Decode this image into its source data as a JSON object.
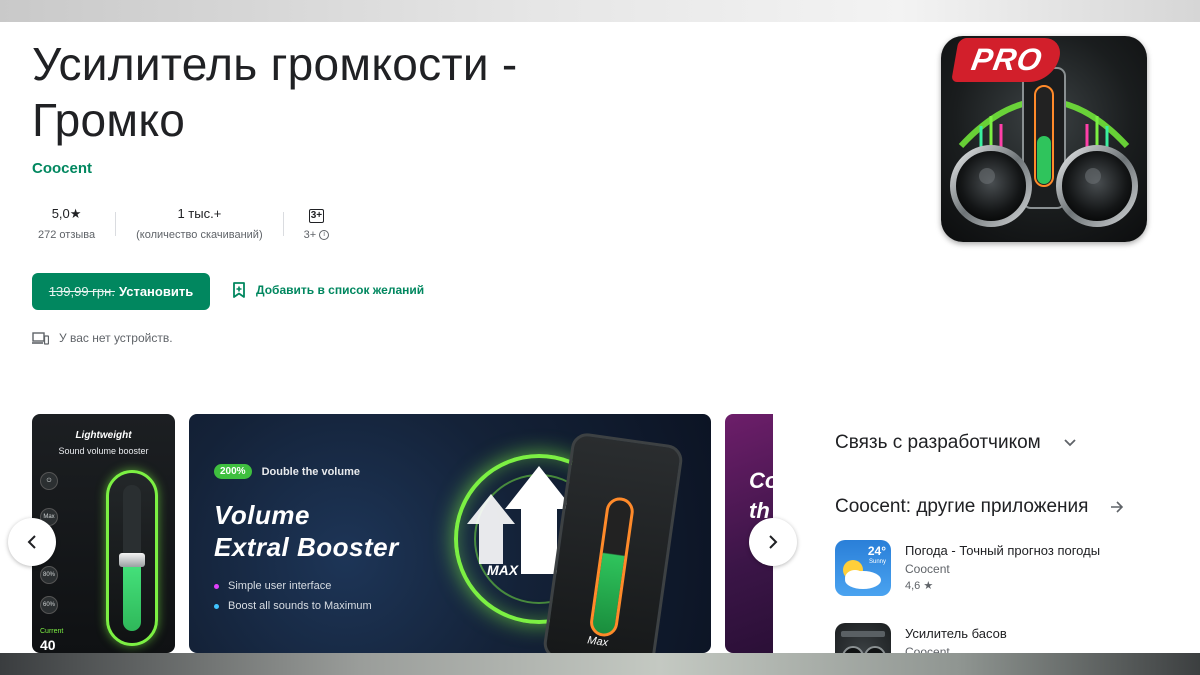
{
  "app": {
    "title_line1": "Усилитель громкости -",
    "title_line2": "Громко",
    "developer": "Coocent",
    "icon_badge": "PRO"
  },
  "stats": {
    "rating": "5,0",
    "rating_star": "★",
    "reviews": "272 отзыва",
    "downloads": "1 тыс.+",
    "downloads_label": "(количество скачиваний)",
    "age_badge": "3+",
    "age_label": "3+"
  },
  "actions": {
    "old_price": "139,99 грн.",
    "install_label": "Установить",
    "wishlist_label": "Добавить в список желаний",
    "install_color": "#01875f"
  },
  "device_note": "У вас нет устройств.",
  "screenshots": {
    "shot1": {
      "title": "Lightweight",
      "subtitle": "Sound volume booster",
      "buttons": [
        "Max",
        "80%",
        "60%",
        "40%"
      ],
      "current_label": "Current",
      "current_value": "40"
    },
    "shot2": {
      "badge_pill": "200%",
      "badge_text": "Double the volume",
      "heading1": "Volume",
      "heading2": "Extral Booster",
      "bullets": [
        {
          "text": "Simple user interface",
          "color": "#e040fb"
        },
        {
          "text": "Boost all sounds to Maximum",
          "color": "#40c4ff"
        }
      ],
      "max_label": "MAX",
      "phone_label": "Max"
    },
    "shot3": {
      "text_line1": "Co",
      "text_line2": "th"
    }
  },
  "sidebar": {
    "contact_title": "Связь с разработчиком",
    "other_apps_title": "Coocent: другие приложения",
    "related": [
      {
        "name": "Погода - Точный прогноз погоды",
        "developer": "Coocent",
        "rating": "4,6 ★",
        "icon": "weather-icon",
        "temp": "24°",
        "sub": "Sunny"
      },
      {
        "name": "Усилитель басов",
        "developer": "Coocent",
        "rating": "",
        "icon": "bass-booster-icon"
      }
    ]
  }
}
